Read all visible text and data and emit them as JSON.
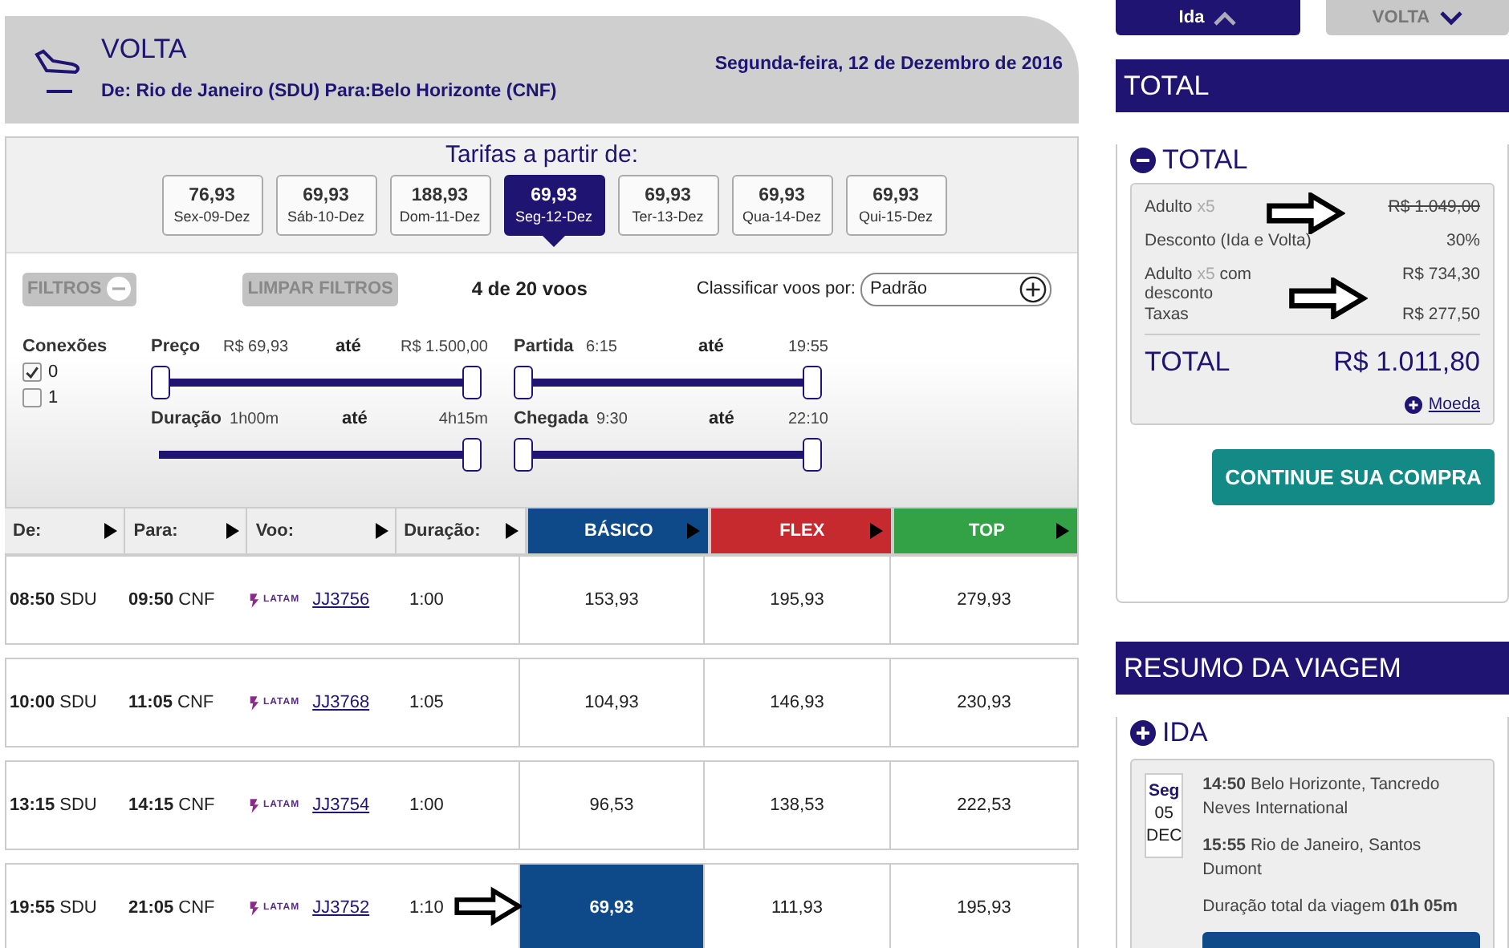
{
  "header": {
    "title": "VOLTA",
    "route": "De: Rio de Janeiro (SDU) Para:Belo Horizonte (CNF)",
    "date": "Segunda-feira, 12 de Dezembro de 2016"
  },
  "fares_title": "Tarifas a partir de:",
  "date_tabs": [
    {
      "price": "76,93",
      "day": "Sex-09-Dez",
      "selected": false
    },
    {
      "price": "69,93",
      "day": "Sáb-10-Dez",
      "selected": false
    },
    {
      "price": "188,93",
      "day": "Dom-11-Dez",
      "selected": false
    },
    {
      "price": "69,93",
      "day": "Seg-12-Dez",
      "selected": true
    },
    {
      "price": "69,93",
      "day": "Ter-13-Dez",
      "selected": false
    },
    {
      "price": "69,93",
      "day": "Qua-14-Dez",
      "selected": false
    },
    {
      "price": "69,93",
      "day": "Qui-15-Dez",
      "selected": false
    }
  ],
  "filters": {
    "toggle": "FILTROS",
    "expanded": true,
    "clear": "LIMPAR FILTROS",
    "count": "4 de 20 voos",
    "sort_label": "Classificar voos por:",
    "sort_value": "Padrão",
    "connections_label": "Conexões",
    "connections": [
      {
        "label": "0",
        "checked": true
      },
      {
        "label": "1",
        "checked": false
      }
    ],
    "sliders": [
      {
        "label": "Preço",
        "from": "R$ 69,93",
        "to_label": "até",
        "to": "R$ 1.500,00",
        "thumbs": [
          {
            "level": 0
          },
          {
            "level": 1
          }
        ]
      },
      {
        "label": "Partida",
        "from": "6:15",
        "to_label": "até",
        "to": "19:55",
        "thumbs": [
          {
            "level": 0
          },
          {
            "level": 1
          }
        ]
      },
      {
        "label": "Duração",
        "from": "1h00m",
        "to_label": "até",
        "to": "4h15m",
        "thumbs": [
          {
            "level": 1
          }
        ]
      },
      {
        "label": "Chegada",
        "from": "9:30",
        "to_label": "até",
        "to": "22:10",
        "thumbs": [
          {
            "level": 0
          },
          {
            "level": 1
          }
        ]
      }
    ]
  },
  "table": {
    "columns": [
      {
        "label": "De:",
        "kind": "plain"
      },
      {
        "label": "Para:",
        "kind": "plain"
      },
      {
        "label": "Voo:",
        "kind": "plain"
      },
      {
        "label": "Duração:",
        "kind": "plain"
      },
      {
        "label": "BÁSICO",
        "kind": "fare",
        "color": "#0e4a8a"
      },
      {
        "label": "FLEX",
        "kind": "fare",
        "color": "#c62a2f"
      },
      {
        "label": "TOP",
        "kind": "fare",
        "color": "#33a145"
      }
    ],
    "rows": [
      {
        "dep_time": "08:50",
        "dep": "SDU",
        "arr_time": "09:50",
        "arr": "CNF",
        "airline": "LATAM",
        "flight": "JJ3756",
        "duration": "1:00",
        "fares": [
          {
            "price": "153,93",
            "selected": false
          },
          {
            "price": "195,93",
            "selected": false
          },
          {
            "price": "279,93",
            "selected": false
          }
        ]
      },
      {
        "dep_time": "10:00",
        "dep": "SDU",
        "arr_time": "11:05",
        "arr": "CNF",
        "airline": "LATAM",
        "flight": "JJ3768",
        "duration": "1:05",
        "fares": [
          {
            "price": "104,93",
            "selected": false
          },
          {
            "price": "146,93",
            "selected": false
          },
          {
            "price": "230,93",
            "selected": false
          }
        ]
      },
      {
        "dep_time": "13:15",
        "dep": "SDU",
        "arr_time": "14:15",
        "arr": "CNF",
        "airline": "LATAM",
        "flight": "JJ3754",
        "duration": "1:00",
        "fares": [
          {
            "price": "96,53",
            "selected": false
          },
          {
            "price": "138,53",
            "selected": false
          },
          {
            "price": "222,53",
            "selected": false
          }
        ]
      },
      {
        "dep_time": "19:55",
        "dep": "SDU",
        "arr_time": "21:05",
        "arr": "CNF",
        "airline": "LATAM",
        "flight": "JJ3752",
        "duration": "1:10",
        "fares": [
          {
            "price": "69,93",
            "selected": true
          },
          {
            "price": "111,93",
            "selected": false
          },
          {
            "price": "195,93",
            "selected": false
          }
        ]
      }
    ]
  },
  "leg_tabs": [
    {
      "label": "Ida",
      "selected": true
    },
    {
      "label": "VOLTA",
      "selected": false
    }
  ],
  "total_panel": {
    "title": "TOTAL",
    "section": "TOTAL",
    "expanded": true,
    "lines": [
      {
        "label": "Adulto",
        "qty": "x5",
        "value": "R$ 1.049,00",
        "struck": true
      },
      {
        "label": "Desconto (Ida e Volta)",
        "value": "30%",
        "struck": false
      },
      {
        "label": "Adulto",
        "qty": "x5",
        "suffix": "com desconto",
        "value": "R$ 734,30",
        "struck": false
      },
      {
        "label": "Taxas",
        "value": "R$ 277,50",
        "struck": false
      }
    ],
    "total_label": "TOTAL",
    "total_value": "R$ 1.011,80",
    "currency": "Moeda",
    "button": "CONTINUE SUA COMPRA"
  },
  "summary": {
    "title": "RESUMO DA VIAGEM",
    "section": "IDA",
    "expanded": false,
    "date": [
      "Seg",
      "05",
      "DEC"
    ],
    "segments": [
      "**14:50** Belo Horizonte, Tancredo Neves International",
      "**15:55** Rio de Janeiro, Santos Dumont"
    ],
    "duration": "Duração total da viagem **01h 05m**"
  }
}
